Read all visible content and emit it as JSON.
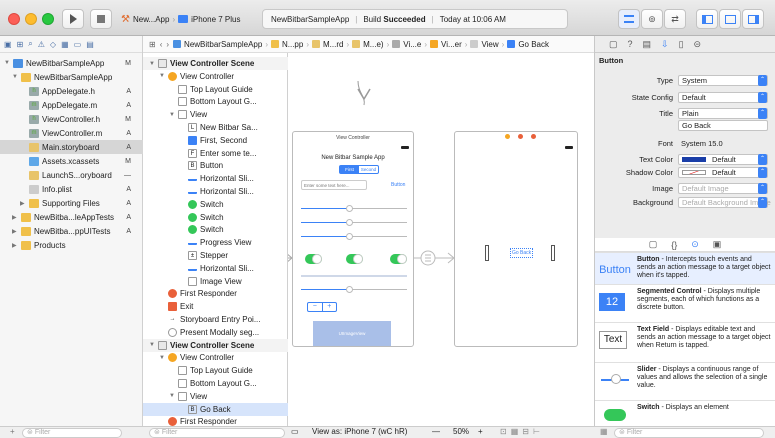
{
  "toolbar": {
    "scheme_app": "New...App",
    "scheme_device": "iPhone 7 Plus",
    "activity_project": "NewBitbarSampleApp",
    "activity_status_prefix": "Build ",
    "activity_status": "Succeeded",
    "activity_time": "Today at 10:06 AM"
  },
  "navigator": {
    "items": [
      {
        "label": "NewBitbarSampleApp",
        "status": "M",
        "indent": 0,
        "color": "#4a90e2",
        "tri": "▼",
        "selected": false,
        "bold": false
      },
      {
        "label": "NewBitbarSampleApp",
        "status": "",
        "indent": 1,
        "color": "#f0c04a",
        "tri": "▼",
        "selected": false,
        "bold": false
      },
      {
        "label": "AppDelegate.h",
        "status": "A",
        "indent": 2,
        "color": "#9aa",
        "glyph": "h",
        "tri": "",
        "selected": false
      },
      {
        "label": "AppDelegate.m",
        "status": "A",
        "indent": 2,
        "color": "#9aa",
        "glyph": "m",
        "tri": "",
        "selected": false
      },
      {
        "label": "ViewController.h",
        "status": "M",
        "indent": 2,
        "color": "#9aa",
        "glyph": "h",
        "tri": "",
        "selected": false
      },
      {
        "label": "ViewController.m",
        "status": "A",
        "indent": 2,
        "color": "#9aa",
        "glyph": "m",
        "tri": "",
        "selected": false
      },
      {
        "label": "Main.storyboard",
        "status": "A",
        "indent": 2,
        "color": "#e8c46a",
        "tri": "",
        "selected": true
      },
      {
        "label": "Assets.xcassets",
        "status": "M",
        "indent": 2,
        "color": "#5fa8e8",
        "tri": "",
        "selected": false
      },
      {
        "label": "LaunchS...oryboard",
        "status": "—",
        "indent": 2,
        "color": "#e8c46a",
        "tri": "",
        "selected": false
      },
      {
        "label": "Info.plist",
        "status": "A",
        "indent": 2,
        "color": "#ccc",
        "tri": "",
        "selected": false
      },
      {
        "label": "Supporting Files",
        "status": "A",
        "indent": 2,
        "color": "#f0c04a",
        "tri": "▶",
        "selected": false
      },
      {
        "label": "NewBitba...leAppTests",
        "status": "A",
        "indent": 1,
        "color": "#f0c04a",
        "tri": "▶",
        "selected": false
      },
      {
        "label": "NewBitba...ppUITests",
        "status": "A",
        "indent": 1,
        "color": "#f0c04a",
        "tri": "▶",
        "selected": false
      },
      {
        "label": "Products",
        "status": "",
        "indent": 1,
        "color": "#f0c04a",
        "tri": "▶",
        "selected": false
      }
    ],
    "filter_placeholder": "Filter"
  },
  "jumpbar": {
    "crumbs": [
      "NewBitbarSampleApp",
      "N...pp",
      "M...rd",
      "M...e)",
      "Vi...e",
      "Vi...er",
      "View",
      "Go Back"
    ]
  },
  "outline": {
    "items": [
      {
        "label": "View Controller Scene",
        "indent": 0,
        "icon": "scene",
        "tri": "▼",
        "bold": true
      },
      {
        "label": "View Controller",
        "indent": 1,
        "icon": "vc",
        "tri": "▼"
      },
      {
        "label": "Top Layout Guide",
        "indent": 2,
        "icon": "box",
        "tri": ""
      },
      {
        "label": "Bottom Layout G...",
        "indent": 2,
        "icon": "box",
        "tri": ""
      },
      {
        "label": "View",
        "indent": 2,
        "icon": "box",
        "tri": "▼"
      },
      {
        "label": "New Bitbar Sa...",
        "indent": 3,
        "icon": "L",
        "tri": ""
      },
      {
        "label": "First, Second",
        "indent": 3,
        "icon": "seg",
        "tri": ""
      },
      {
        "label": "Enter some te...",
        "indent": 3,
        "icon": "F",
        "tri": ""
      },
      {
        "label": "Button",
        "indent": 3,
        "icon": "B",
        "tri": ""
      },
      {
        "label": "Horizontal Sli...",
        "indent": 3,
        "icon": "slider",
        "tri": ""
      },
      {
        "label": "Horizontal Sli...",
        "indent": 3,
        "icon": "slider",
        "tri": ""
      },
      {
        "label": "Switch",
        "indent": 3,
        "icon": "switch",
        "tri": ""
      },
      {
        "label": "Switch",
        "indent": 3,
        "icon": "switch",
        "tri": ""
      },
      {
        "label": "Switch",
        "indent": 3,
        "icon": "switch",
        "tri": ""
      },
      {
        "label": "Progress View",
        "indent": 3,
        "icon": "progress",
        "tri": ""
      },
      {
        "label": "Stepper",
        "indent": 3,
        "icon": "stepper",
        "tri": ""
      },
      {
        "label": "Horizontal Sli...",
        "indent": 3,
        "icon": "slider",
        "tri": ""
      },
      {
        "label": "Image View",
        "indent": 3,
        "icon": "box",
        "tri": ""
      },
      {
        "label": "First Responder",
        "indent": 1,
        "icon": "fr",
        "tri": ""
      },
      {
        "label": "Exit",
        "indent": 1,
        "icon": "exit",
        "tri": ""
      },
      {
        "label": "Storyboard Entry Poi...",
        "indent": 1,
        "icon": "arrow",
        "tri": ""
      },
      {
        "label": "Present Modally seg...",
        "indent": 1,
        "icon": "segue",
        "tri": ""
      },
      {
        "label": "View Controller Scene",
        "indent": 0,
        "icon": "scene",
        "tri": "▼",
        "bold": true
      },
      {
        "label": "View Controller",
        "indent": 1,
        "icon": "vc",
        "tri": "▼"
      },
      {
        "label": "Top Layout Guide",
        "indent": 2,
        "icon": "box",
        "tri": ""
      },
      {
        "label": "Bottom Layout G...",
        "indent": 2,
        "icon": "box",
        "tri": ""
      },
      {
        "label": "View",
        "indent": 2,
        "icon": "box",
        "tri": "▼"
      },
      {
        "label": "Go Back",
        "indent": 3,
        "icon": "B",
        "tri": "",
        "selected": true
      },
      {
        "label": "First Responder",
        "indent": 1,
        "icon": "fr",
        "tri": ""
      }
    ],
    "filter_placeholder": "Filter"
  },
  "canvas": {
    "scene1_title": "View Controller",
    "app_title": "New Bitbar Sample App",
    "seg_first": "First",
    "seg_second": "Second",
    "text_placeholder": "Enter some text here...",
    "button_label": "Button",
    "image_label": "UIImageView",
    "slider_levels": [
      0.45,
      0.45,
      0.45
    ],
    "progress_level": 0,
    "goback_label": "Go Back",
    "view_as": "View as: iPhone 7 (wC hR)",
    "zoom": "50%",
    "zoom_minus": "—",
    "zoom_plus": "+"
  },
  "inspector": {
    "section": "Button",
    "rows": [
      {
        "label": "Type",
        "value": "System"
      },
      {
        "label": "State Config",
        "value": "Default"
      },
      {
        "label": "Title",
        "value": "Plain"
      },
      {
        "label": "",
        "value": "Go Back"
      },
      {
        "label": "Font",
        "value": "System 15.0"
      },
      {
        "label": "Text Color",
        "value": "Default"
      },
      {
        "label": "Shadow Color",
        "value": "Default"
      },
      {
        "label": "Image",
        "value": "Default Image"
      },
      {
        "label": "Background",
        "value": "Default Background Image"
      }
    ]
  },
  "library": {
    "items": [
      {
        "badge": "Button",
        "title": "Button",
        "desc": " - Intercepts touch events and sends an action message to a target object when it's tapped."
      },
      {
        "badge": "12",
        "title": "Segmented Control",
        "desc": " - Displays multiple segments, each of which functions as a discrete button."
      },
      {
        "badge": "Text",
        "title": "Text Field",
        "desc": " - Displays editable text and sends an action message to a target object when Return is tapped."
      },
      {
        "badge": "slider",
        "title": "Slider",
        "desc": " - Displays a continuous range of values and allows the selection of a single value."
      },
      {
        "badge": "switch",
        "title": "Switch",
        "desc": " - Displays an element"
      }
    ],
    "filter_placeholder": "Filter"
  }
}
